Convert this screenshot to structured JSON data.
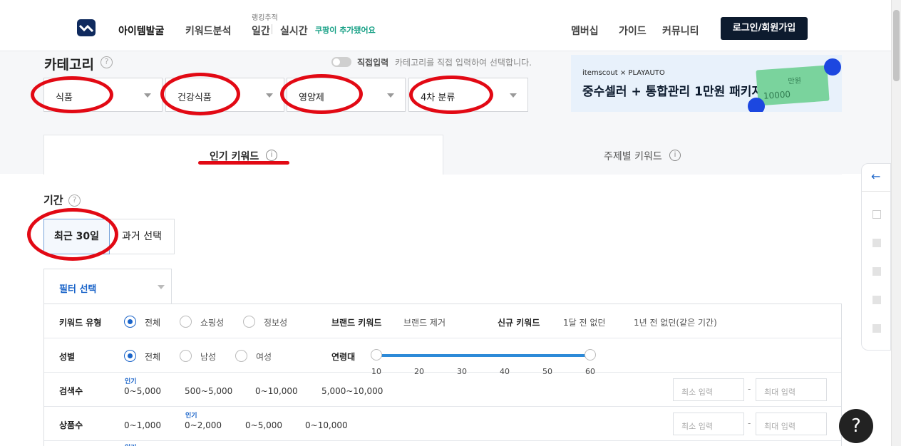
{
  "nav": {
    "items": [
      "아이템발굴",
      "키워드분석"
    ],
    "ranking_caption": "랭킹추적",
    "ranking_daily": "일간",
    "ranking_realtime": "실시간",
    "coupang_note": "쿠팡이 추가됐어요",
    "right_items": [
      "멤버십",
      "가이드",
      "커뮤니티"
    ],
    "login_label": "로그인/회원가입"
  },
  "category": {
    "title": "카테고리",
    "direct_label": "직접입력",
    "direct_desc": "카테고리를 직접 입력하여 선택합니다.",
    "selects": [
      "식품",
      "건강식품",
      "영양제",
      "4차 분류"
    ]
  },
  "banner": {
    "logo_text": "itemscout × PLAYAUTO",
    "headline": "중수셀러 + 통합관리 1만원 패키지",
    "bill_value": "10000",
    "bill_word": "만원"
  },
  "tabs": {
    "popular": "인기 키워드",
    "topic": "주제별 키워드"
  },
  "period": {
    "title": "기간",
    "recent": "최근 30일",
    "past": "과거 선택"
  },
  "filter": {
    "tab_label": "필터 선택",
    "keyword_type": {
      "label": "키워드 유형",
      "options": [
        "전체",
        "쇼핑성",
        "정보성"
      ],
      "brand_label": "브랜드 키워드",
      "brand_value": "브랜드 제거",
      "new_label": "신규 키워드",
      "new_options": [
        "1달 전 없던",
        "1년 전 없던(같은 기간)"
      ]
    },
    "gender": {
      "label": "성별",
      "options": [
        "전체",
        "남성",
        "여성"
      ],
      "age_label": "연령대",
      "age_ticks": [
        "10",
        "20",
        "30",
        "40",
        "50",
        "60"
      ]
    },
    "search_count": {
      "label": "검색수",
      "popular_tag": "인기",
      "ranges": [
        "0~5,000",
        "500~5,000",
        "0~10,000",
        "5,000~10,000"
      ],
      "min_placeholder": "최소 입력",
      "max_placeholder": "최대 입력"
    },
    "product_count": {
      "label": "상품수",
      "popular_tag": "인기",
      "ranges": [
        "0~1,000",
        "0~2,000",
        "0~5,000",
        "0~10,000"
      ],
      "min_placeholder": "최소 입력",
      "max_placeholder": "최대 입력"
    },
    "extra_popular_tag": "인기"
  },
  "side_panel": {
    "arrow": "←"
  },
  "help_label": "?",
  "colors": {
    "accent": "#1a64c9",
    "annotation": "#e20914",
    "dark": "#0d1b2e"
  }
}
